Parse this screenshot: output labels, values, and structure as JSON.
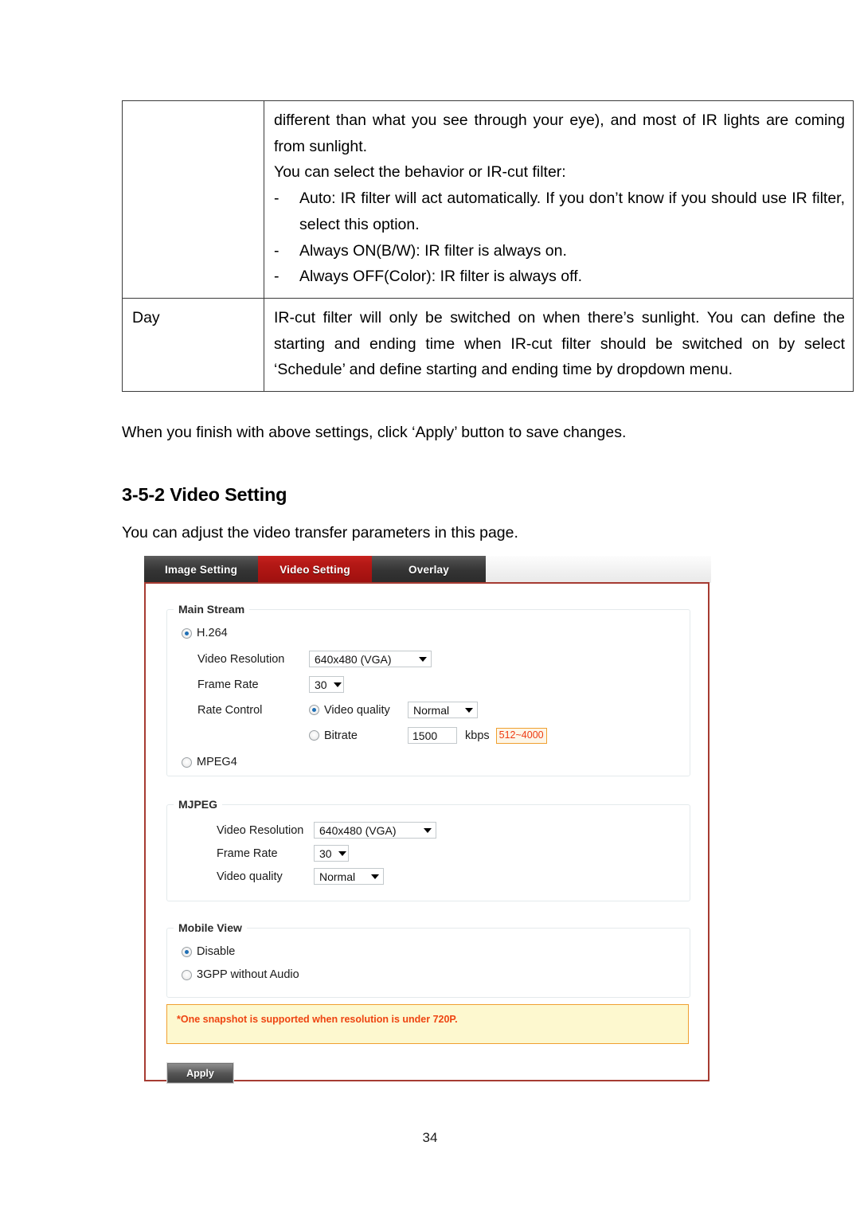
{
  "document": {
    "page_number": "34",
    "table": {
      "rows": [
        {
          "label": "",
          "paragraphs": [
            "different than what you see through your eye), and most of IR lights are coming from sunlight.",
            "You can select the behavior or IR-cut filter:"
          ],
          "bullets": [
            {
              "dash": "-",
              "text": "Auto: IR filter will act automatically. If you don’t know if you should use IR filter, select this option."
            },
            {
              "dash": "-",
              "text": "Always ON(B/W): IR filter is always on."
            },
            {
              "dash": "-",
              "text": "Always OFF(Color): IR filter is always off."
            }
          ]
        },
        {
          "label": "Day",
          "paragraphs": [
            "IR-cut filter will only be switched on when there’s sunlight. You can define the starting and ending time when IR-cut filter should be switched on by select ‘Schedule’ and define starting and ending time by dropdown menu."
          ],
          "bullets": []
        }
      ]
    },
    "paragraph_apply": "When you finish with above settings, click ‘Apply’ button to save changes.",
    "heading": "3-5-2 Video Setting",
    "paragraph_intro": "You can adjust the video transfer parameters in this page."
  },
  "camera_ui": {
    "tabs": [
      {
        "label": "Image Setting",
        "active": false
      },
      {
        "label": "Video Setting",
        "active": true
      },
      {
        "label": "Overlay",
        "active": false
      }
    ],
    "main_stream": {
      "legend": "Main Stream",
      "codec_h264": {
        "label": "H.264",
        "selected": true
      },
      "codec_mpeg4": {
        "label": "MPEG4",
        "selected": false
      },
      "video_resolution": {
        "label": "Video Resolution",
        "value": "640x480 (VGA)"
      },
      "frame_rate": {
        "label": "Frame Rate",
        "value": "30"
      },
      "rate_control": {
        "label": "Rate Control",
        "video_quality": {
          "label": "Video quality",
          "selected": true,
          "value": "Normal"
        },
        "bitrate": {
          "label": "Bitrate",
          "selected": false,
          "value": "1500",
          "unit": "kbps",
          "range_hint": "512~4000"
        }
      }
    },
    "mjpeg": {
      "legend": "MJPEG",
      "video_resolution": {
        "label": "Video Resolution",
        "value": "640x480 (VGA)"
      },
      "frame_rate": {
        "label": "Frame Rate",
        "value": "30"
      },
      "video_quality": {
        "label": "Video quality",
        "value": "Normal"
      }
    },
    "mobile_view": {
      "legend": "Mobile View",
      "options": [
        {
          "label": "Disable",
          "selected": true
        },
        {
          "label": "3GPP without Audio",
          "selected": false
        }
      ]
    },
    "note": "*One snapshot is supported when resolution is under 720P.",
    "apply_button": "Apply"
  },
  "colors": {
    "tab_active": "#b51916",
    "panel_border": "#a63b32",
    "note_bg": "#fdf8cf",
    "note_text": "#ee4411",
    "hint_border": "#f0a030",
    "radio_dot": "#1f6fb5"
  }
}
